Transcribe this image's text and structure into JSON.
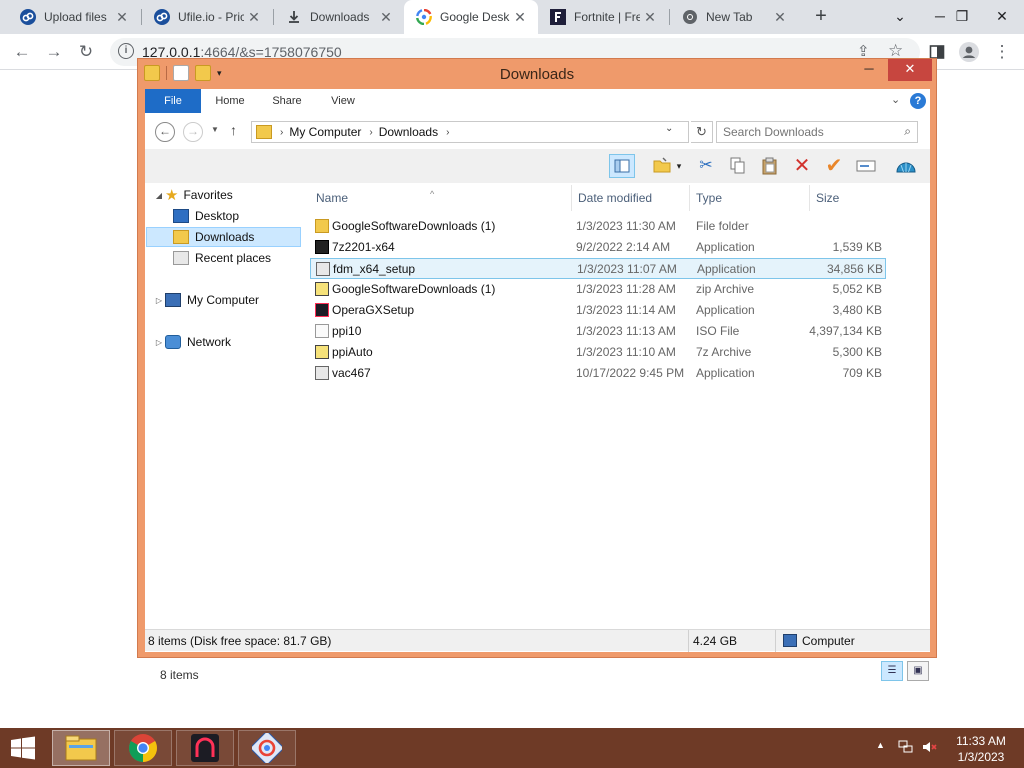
{
  "browser": {
    "tabs": [
      {
        "title": "Upload files",
        "icon": "ufile-icon",
        "active": false
      },
      {
        "title": "Ufile.io - Pric",
        "icon": "ufile-icon",
        "active": false
      },
      {
        "title": "Downloads",
        "icon": "download-icon",
        "active": false
      },
      {
        "title": "Google Desk",
        "icon": "google-desktop-icon",
        "active": true
      },
      {
        "title": "Fortnite | Fre",
        "icon": "fortnite-icon",
        "active": false
      },
      {
        "title": "New Tab",
        "icon": "chrome-icon",
        "active": false
      }
    ],
    "new_tab_symbol": "+",
    "url": "127.0.0.1:4664/&s=1758076750",
    "url_host": "127.0.0.1",
    "url_rest": ":4664/&s=1758076750"
  },
  "explorer": {
    "title": "Downloads",
    "ribbon_tabs": [
      "File",
      "Home",
      "Share",
      "View"
    ],
    "breadcrumb": [
      "My Computer",
      "Downloads"
    ],
    "search_placeholder": "Search Downloads",
    "nav": {
      "favorites": "Favorites",
      "desktop": "Desktop",
      "downloads": "Downloads",
      "recent_places": "Recent places",
      "my_computer": "My Computer",
      "network": "Network"
    },
    "columns": {
      "name": "Name",
      "date": "Date modified",
      "type": "Type",
      "size": "Size"
    },
    "files": [
      {
        "name": "GoogleSoftwareDownloads (1)",
        "date": "1/3/2023 11:30 AM",
        "type": "File folder",
        "size": "",
        "icon": "folder-icon",
        "selected": false
      },
      {
        "name": "7z2201-x64",
        "date": "9/2/2022 2:14 AM",
        "type": "Application",
        "size": "1,539 KB",
        "icon": "7zip-icon",
        "selected": false
      },
      {
        "name": "fdm_x64_setup",
        "date": "1/3/2023 11:07 AM",
        "type": "Application",
        "size": "34,856 KB",
        "icon": "installer-icon",
        "selected": true
      },
      {
        "name": "GoogleSoftwareDownloads (1)",
        "date": "1/3/2023 11:28 AM",
        "type": "zip Archive",
        "size": "5,052 KB",
        "icon": "zip-archive-icon",
        "selected": false
      },
      {
        "name": "OperaGXSetup",
        "date": "1/3/2023 11:14 AM",
        "type": "Application",
        "size": "3,480 KB",
        "icon": "opera-gx-icon",
        "selected": false
      },
      {
        "name": "ppi10",
        "date": "1/3/2023 11:13 AM",
        "type": "ISO File",
        "size": "4,397,134 KB",
        "icon": "iso-file-icon",
        "selected": false
      },
      {
        "name": "ppiAuto",
        "date": "1/3/2023 11:10 AM",
        "type": "7z Archive",
        "size": "5,300 KB",
        "icon": "7z-archive-icon",
        "selected": false
      },
      {
        "name": "vac467",
        "date": "10/17/2022 9:45 PM",
        "type": "Application",
        "size": "709 KB",
        "icon": "installer-icon",
        "selected": false
      }
    ],
    "items_count": "8 items",
    "status": {
      "left": "8 items (Disk free space: 81.7 GB)",
      "middle": "4.24 GB",
      "right": "Computer"
    }
  },
  "taskbar": {
    "clock_time": "11:33 AM",
    "clock_date": "1/3/2023",
    "pinned": [
      "file-explorer-icon",
      "chrome-icon",
      "opera-gx-icon",
      "google-desktop-icon"
    ],
    "colors": {
      "taskbar": "#6e3a26",
      "window_frame": "#ef9a6b",
      "accent": "#1e6cc7"
    }
  }
}
